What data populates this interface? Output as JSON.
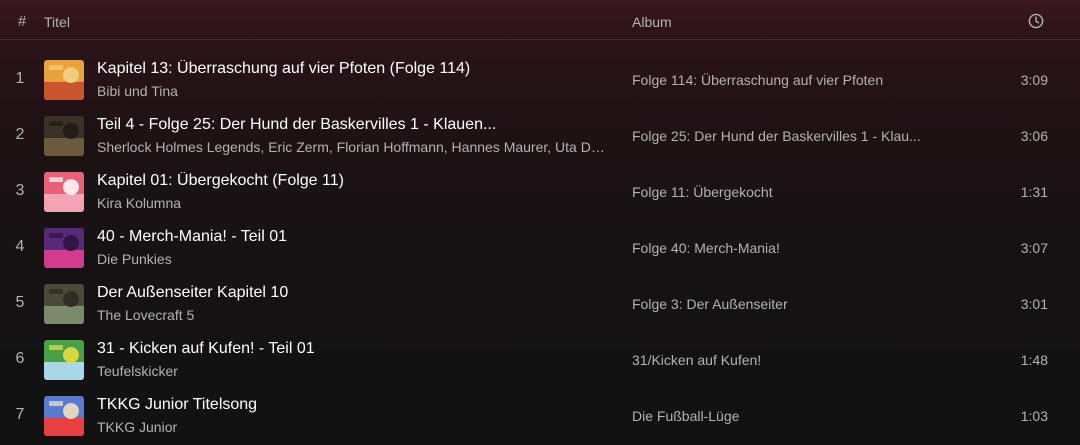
{
  "header": {
    "num_label": "#",
    "title_label": "Titel",
    "album_label": "Album",
    "duration_icon": "clock-icon"
  },
  "tracks": [
    {
      "num": "1",
      "title": "Kapitel 13: Überraschung auf vier Pfoten (Folge 114)",
      "artist": "Bibi und Tina",
      "album": "Folge 114: Überraschung auf vier Pfoten",
      "duration": "3:09",
      "cover_colors": [
        "#e8a23a",
        "#c9552e",
        "#f3d28a"
      ]
    },
    {
      "num": "2",
      "title": "Teil 4 - Folge 25: Der Hund der Baskervilles 1 - Klauen...",
      "artist": "Sherlock Holmes Legends, Eric Zerm, Florian Hoffmann, Hannes Maurer, Uta Dä...",
      "album": "Folge 25: Der Hund der Baskervilles 1 - Klau...",
      "duration": "3:06",
      "cover_colors": [
        "#3a3226",
        "#6b5a3e",
        "#1e1a14"
      ]
    },
    {
      "num": "3",
      "title": "Kapitel 01: Übergekocht (Folge 11)",
      "artist": "Kira Kolumna",
      "album": "Folge 11: Übergekocht",
      "duration": "1:31",
      "cover_colors": [
        "#e8607a",
        "#f4a3b5",
        "#ffffff"
      ]
    },
    {
      "num": "4",
      "title": "40 - Merch-Mania! - Teil 01",
      "artist": "Die Punkies",
      "album": "Folge 40: Merch-Mania!",
      "duration": "3:07",
      "cover_colors": [
        "#5a2a7a",
        "#d23c8c",
        "#2a1440"
      ]
    },
    {
      "num": "5",
      "title": "Der Außenseiter Kapitel 10",
      "artist": "The Lovecraft 5",
      "album": "Folge 3: Der Außenseiter",
      "duration": "3:01",
      "cover_colors": [
        "#4a4a3a",
        "#7a8a6a",
        "#2a2a22"
      ]
    },
    {
      "num": "6",
      "title": "31 - Kicken auf Kufen! - Teil 01",
      "artist": "Teufelskicker",
      "album": "31/Kicken auf Kufen!",
      "duration": "1:48",
      "cover_colors": [
        "#4aa046",
        "#a8d8e8",
        "#f0e040"
      ]
    },
    {
      "num": "7",
      "title": "TKKG Junior Titelsong",
      "artist": "TKKG Junior",
      "album": "Die Fußball-Lüge",
      "duration": "1:03",
      "cover_colors": [
        "#5a7ad0",
        "#e84040",
        "#f8e8c0"
      ]
    }
  ]
}
